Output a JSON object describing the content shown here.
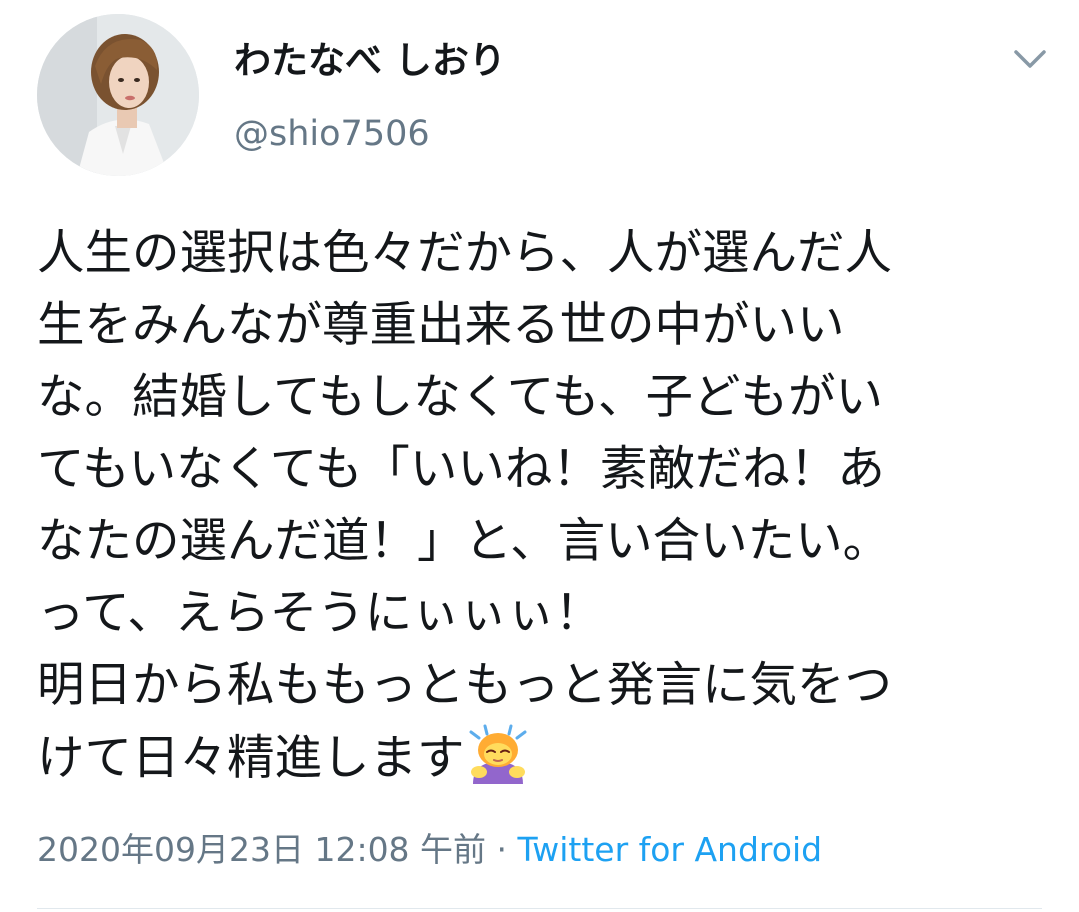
{
  "tweet": {
    "display_name": "わたなべ しおり",
    "handle": "@shio7506",
    "body_lines": [
      "人生の選択は色々だから、人が選んだ人",
      "生をみんなが尊重出来る世の中がいい",
      "な。結婚してもしなくても、子どもがい",
      "てもいなくても「いいね！素敵だね！あ",
      "なたの選んだ道！」と、言い合いたい。",
      "って、えらそうにぃぃぃ！",
      "明日から私ももっともっと発言に気をつ",
      "けて日々精進します"
    ],
    "emoji_icon": "person-bowing-emoji-icon",
    "timestamp": "2020年09月23日 12:08 午前",
    "separator": " · ",
    "source": "Twitter for Android"
  },
  "colors": {
    "text": "#14171a",
    "secondary": "#657786",
    "link": "#1da1f2",
    "divider": "#e1e8ed"
  }
}
